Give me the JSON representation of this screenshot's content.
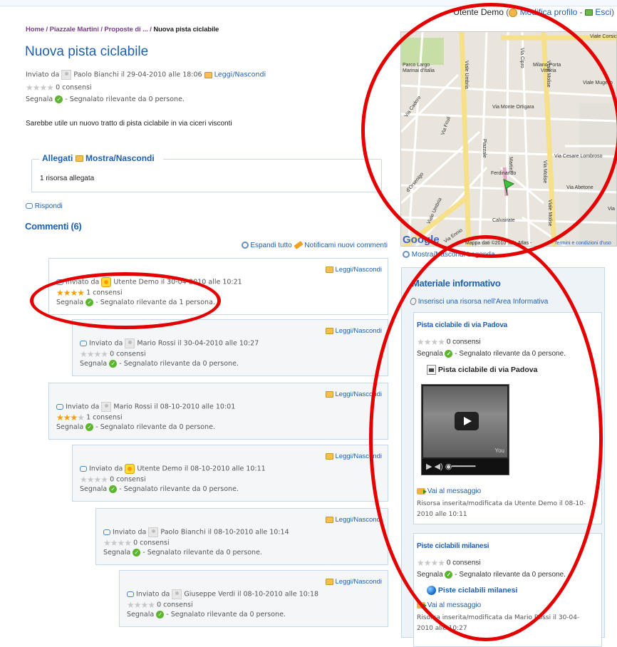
{
  "user": {
    "name": "Utente Demo",
    "modify_label": "Modifica profilo",
    "separator": "-",
    "exit_label": "Esci"
  },
  "breadcrumb": {
    "items": [
      "Home",
      "Piazzale Martini",
      "Proposte di ..."
    ],
    "current": "Nuova pista ciclabile"
  },
  "post": {
    "title": "Nuova pista ciclabile",
    "sent_by_label": "Inviato da",
    "author": "Paolo Bianchi",
    "date_text": "il 29-04-2010 alle 18:06",
    "toggle_label": "Leggi/Nascondi",
    "consensi": "0 consensi",
    "segnala_label": "Segnala",
    "rilevante_text": "- Segnalato rilevante da 0 persone.",
    "body": "Sarebbe utile un nuovo tratto di pista ciclabile in via ciceri visconti"
  },
  "allegati": {
    "title": "Allegati",
    "toggle_label": "Mostra/Nascondi",
    "count_text": "1 risorsa allegata"
  },
  "rispondi_label": "Rispondi",
  "commenti_title": "Commenti (6)",
  "comment_tools": {
    "expand_label": "Espandi tutto",
    "notify_label": "Notificami nuovi commenti"
  },
  "comments": [
    {
      "author": "Utente Demo",
      "date": "il 30-04-2010 alle 10:21",
      "rating": 4,
      "consensi": "1 consensi",
      "rilevante": "- Segnalato rilevante da 1 persona.",
      "avatar": "demo"
    },
    {
      "author": "Mario Rossi",
      "date": "il 30-04-2010 alle 10:27",
      "rating": 0,
      "consensi": "0 consensi",
      "rilevante": "- Segnalato rilevante da 0 persone.",
      "avatar": "user"
    },
    {
      "author": "Mario Rossi",
      "date": "il 08-10-2010 alle 10:01",
      "rating": 3,
      "consensi": "1 consensi",
      "rilevante": "- Segnalato rilevante da 0 persone.",
      "avatar": "user"
    },
    {
      "author": "Utente Demo",
      "date": "il 08-10-2010 alle 10:11",
      "rating": 0,
      "consensi": "0 consensi",
      "rilevante": "- Segnalato rilevante da 0 persone.",
      "avatar": "demo"
    },
    {
      "author": "Paolo Bianchi",
      "date": "il 08-10-2010 alle 10:14",
      "rating": 0,
      "consensi": "0 consensi",
      "rilevante": "- Segnalato rilevante da 0 persone.",
      "avatar": "user"
    },
    {
      "author": "Giuseppe Verdi",
      "date": "il 08-10-2010 alle 10:18",
      "rating": 0,
      "consensi": "0 consensi",
      "rilevante": "- Segnalato rilevante da 0 persone.",
      "avatar": "user"
    }
  ],
  "comment_labels": {
    "sent_by": "Inviato da",
    "toggle": "Leggi/Nascondi",
    "segnala": "Segnala"
  },
  "map": {
    "streets": [
      "Viale Corsica",
      "Via Cipro",
      "Parco Largo Marinai d'Italia",
      "Milano Porta Vittoria",
      "Viale Umbria",
      "Via Cadore",
      "Viale Molise",
      "Viale Mugello",
      "Via Monte Ortigara",
      "Via Friuli",
      "Piazzale",
      "Ferdinando",
      "Martini",
      "Via Cesare Lombroso",
      "d'Orsenigo",
      "Viale Umbria",
      "Via Molise",
      "Via Abetone",
      "Viale Molise",
      "Calvairate",
      "Via Ennio",
      "Via O"
    ],
    "google_label": "Google",
    "copyright": "Mappa dati ©2010 Tele Atlas -",
    "terms": "Termini e condizioni d'uso",
    "legend_link": "Mostra/Nascondi Legenda"
  },
  "materiale": {
    "title": "Materiale informativo",
    "insert_label": "Inserisci una risorsa nell'Area Informativa",
    "resources": [
      {
        "title": "Pista ciclabile di via Padova",
        "consensi": "0 consensi",
        "segnala": "Segnala",
        "rilevante": "- Segnalato rilevante da 0 persone.",
        "sub_title": "Pista ciclabile di via Padova",
        "link_label": "Vai al messaggio",
        "footer": "Risorsa inserita/modificata da Utente Demo il 08-10-2010 alle 10:11"
      },
      {
        "title": "Piste ciclabili milanesi",
        "consensi": "0 consensi",
        "segnala": "Segnala",
        "rilevante": "- Segnalato rilevante da 0 persone.",
        "sub_title": "Piste ciclabili milanesi",
        "link_label": "Vai al messaggio",
        "footer": "Risorsa inserita/modificata da Mario Rossi il 30-04-2010 alle 10:27"
      }
    ]
  },
  "colors": {
    "link": "#1f5fae",
    "annotation": "#e50000",
    "border": "#c5d8ea"
  }
}
